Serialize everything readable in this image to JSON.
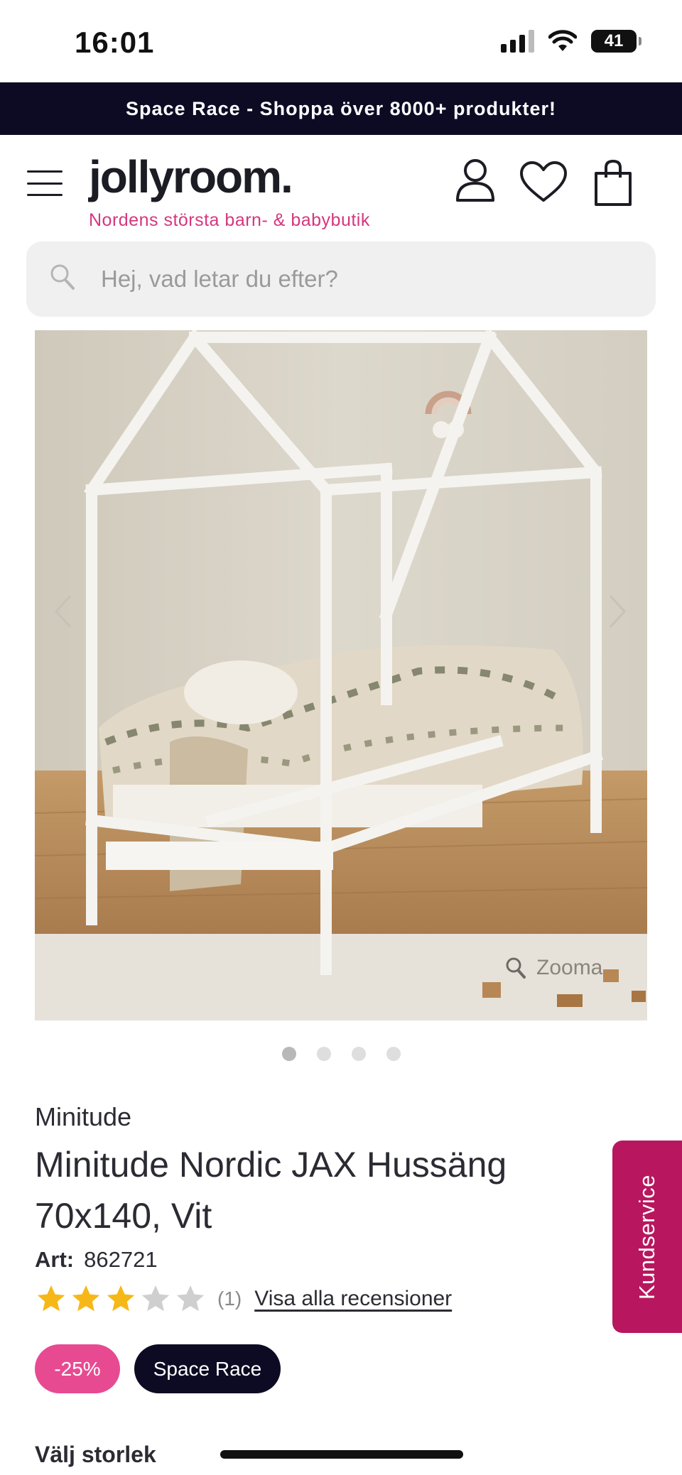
{
  "status_bar": {
    "time": "16:01",
    "battery": "41"
  },
  "promo_banner": {
    "text": "Space Race - Shoppa över 8000+ produkter!"
  },
  "header": {
    "logo": "jollyroom.",
    "tagline": "Nordens största barn- & babybutik"
  },
  "search": {
    "placeholder": "Hej, vad letar du efter?"
  },
  "gallery": {
    "zoom_label": "Zooma",
    "total_images": 4,
    "active_index": 1
  },
  "product": {
    "brand": "Minitude",
    "title": "Minitude Nordic JAX Hussäng 70x140, Vit",
    "art_label": "Art:",
    "art_number": "862721",
    "rating": 3,
    "rating_max": 5,
    "review_count": "(1)",
    "reviews_link": "Visa alla recensioner",
    "discount_badge": "-25%",
    "campaign_badge": "Space Race",
    "size_label": "Välj storlek"
  },
  "customer_service": {
    "label": "Kundservice"
  },
  "colors": {
    "brand_pink": "#d6367f",
    "banner_navy": "#0d0b24",
    "discount_pink": "#e84a92",
    "service_tab": "#b8175f",
    "star_gold": "#f6b818",
    "star_grey": "#cfcfcf"
  }
}
